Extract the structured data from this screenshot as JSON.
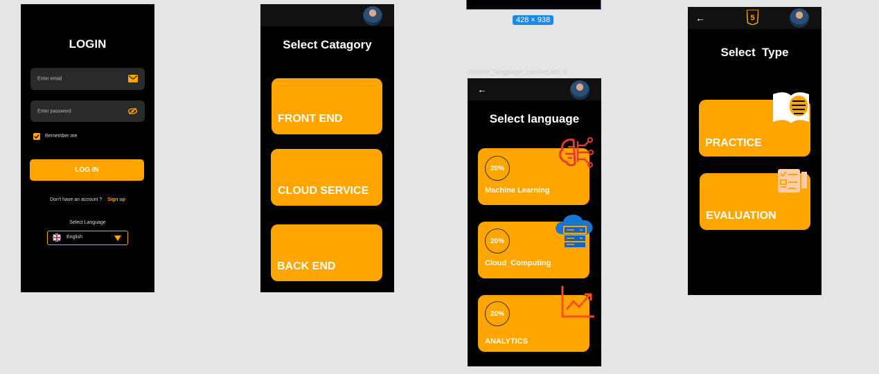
{
  "login": {
    "title": "LOGIN",
    "email_placeholder": "Enter email",
    "password_placeholder": "Enter password",
    "remember_label": "Remember me",
    "login_button": "LOG IN",
    "no_account_text": "Don't have an account ?",
    "signup_link": "Sign up",
    "language_label": "Select Language",
    "language_value": "English"
  },
  "category": {
    "title": "Select Catagory",
    "cards": [
      {
        "label": "FRONT END",
        "icon": "flutter-html5-icon"
      },
      {
        "label": "CLOUD SERVICE",
        "icon": "aws-logo-icon"
      },
      {
        "label": "BACK END",
        "icon": "mongodb-leaf-icon"
      }
    ]
  },
  "frame_size_badge": "428 × 938",
  "language_screen": {
    "frame_label": "choose_language_cardsreade.d",
    "title": "Select language",
    "cards": [
      {
        "percent": "20%",
        "label": "Machine Learning",
        "icon": "brain-circuit-icon"
      },
      {
        "percent": "20%",
        "label": "Cloud_Computing",
        "icon": "cloud-server-icon"
      },
      {
        "percent": "20%",
        "label": "ANALYTICS",
        "icon": "chart-up-icon"
      }
    ]
  },
  "type_screen": {
    "title": "Select  Type",
    "cards": [
      {
        "label": "PRACTICE",
        "icon": "book-icon"
      },
      {
        "label": "EVALUATION",
        "icon": "checklist-icon"
      }
    ]
  },
  "colors": {
    "accent": "#ffa500",
    "background": "#000000",
    "canvas": "#e5e5e5",
    "badge": "#1e88e5"
  }
}
